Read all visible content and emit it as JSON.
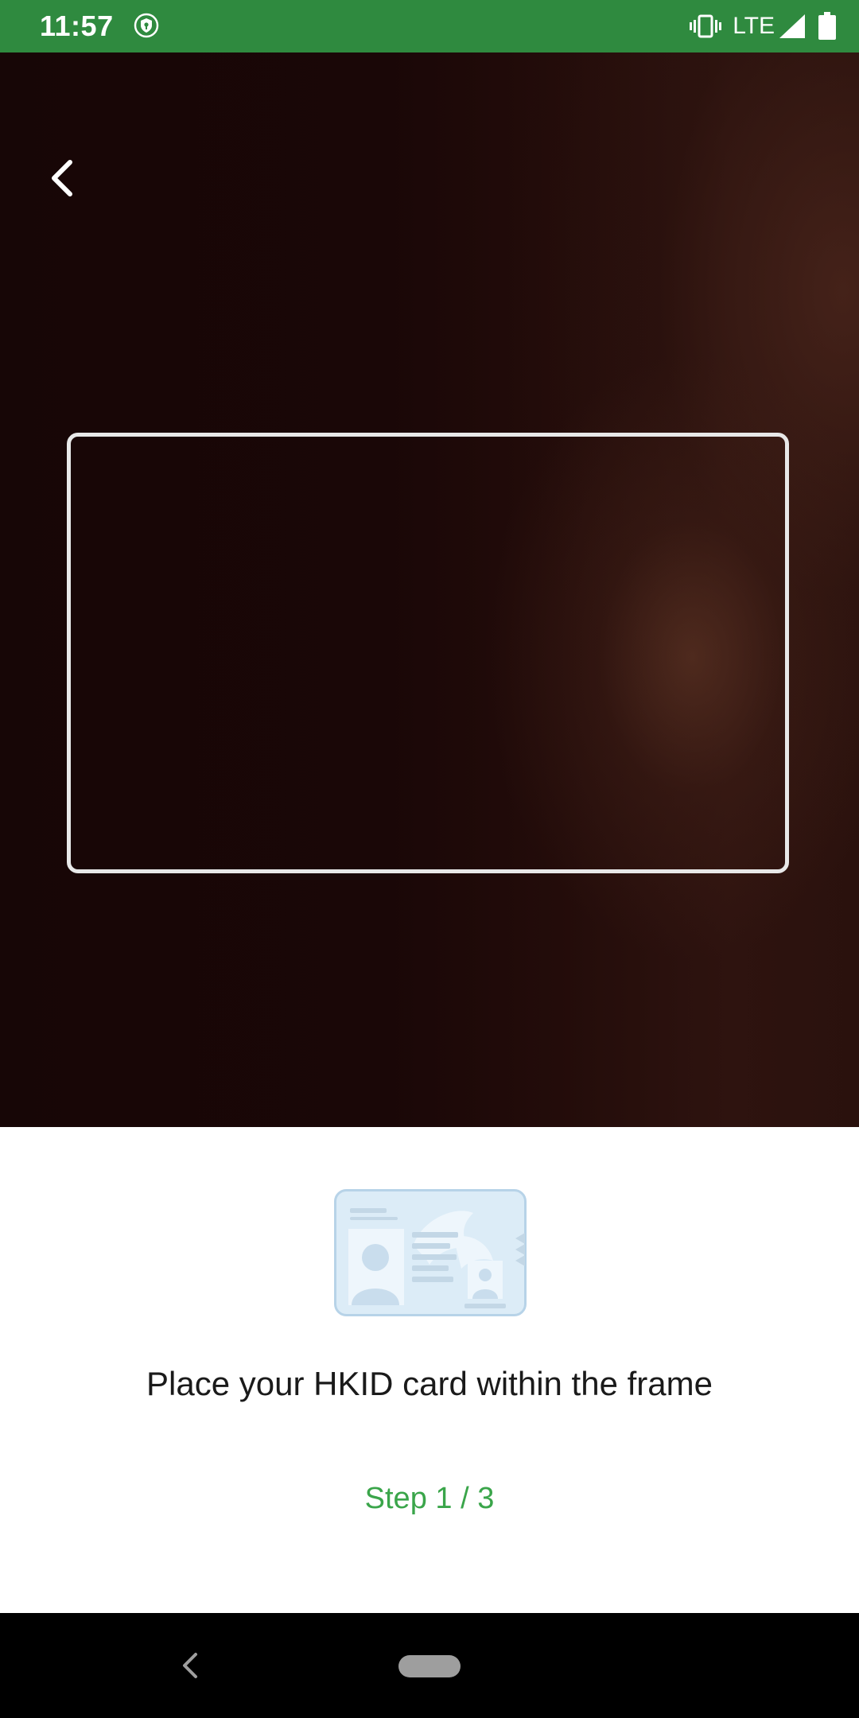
{
  "status_bar": {
    "time": "11:57",
    "network": "LTE",
    "icons": [
      "shield-icon",
      "vibrate-icon",
      "signal-icon",
      "battery-icon"
    ],
    "background_color": "#2f8a3f"
  },
  "camera": {
    "back_icon": "chevron-left-icon",
    "frame_color": "#e8e8e8"
  },
  "panel": {
    "illustration": "id-card-icon",
    "instruction": "Place your HKID card within the frame",
    "step": "Step 1 / 3",
    "step_color": "#3aa54a"
  },
  "nav_bar": {
    "icons": [
      "nav-back-icon",
      "nav-home-pill"
    ]
  }
}
